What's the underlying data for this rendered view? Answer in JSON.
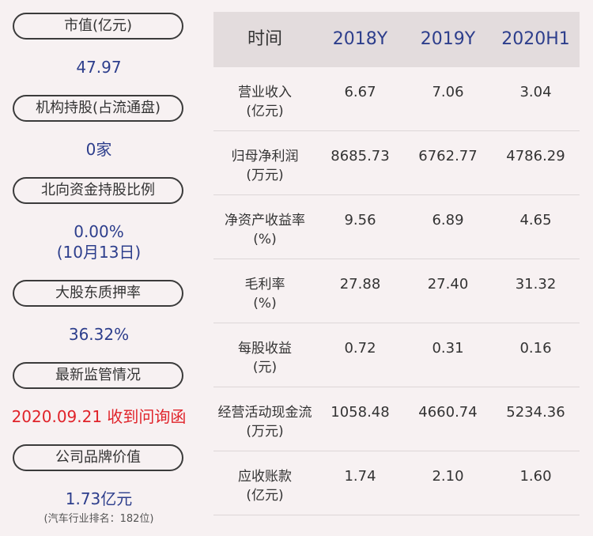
{
  "left": {
    "items": [
      {
        "label": "市值(亿元)",
        "value": "47.97"
      },
      {
        "label": "机构持股(占流通盘)",
        "value": "0家"
      },
      {
        "label": "北向资金持股比例",
        "value": "0.00%",
        "value2": "(10月13日)"
      },
      {
        "label": "大股东质押率",
        "value": "36.32%"
      },
      {
        "label": "最新监管情况",
        "value": "2020.09.21 收到问询函"
      },
      {
        "label": "公司品牌价值",
        "value": "1.73亿元",
        "note": "(汽车行业排名：182位)"
      }
    ],
    "colors": {
      "value": "#2d3e8c",
      "alert": "#e0232a"
    }
  },
  "table": {
    "header": {
      "label": "时间",
      "years": [
        "2018Y",
        "2019Y",
        "2020H1"
      ]
    },
    "rows": [
      {
        "label": "营业收入",
        "unit": "(亿元)",
        "values": [
          "6.67",
          "7.06",
          "3.04"
        ]
      },
      {
        "label": "归母净利润",
        "unit": "(万元)",
        "values": [
          "8685.73",
          "6762.77",
          "4786.29"
        ]
      },
      {
        "label": "净资产收益率",
        "unit": "(%)",
        "values": [
          "9.56",
          "6.89",
          "4.65"
        ]
      },
      {
        "label": "毛利率",
        "unit": "(%)",
        "values": [
          "27.88",
          "27.40",
          "31.32"
        ]
      },
      {
        "label": "每股收益",
        "unit": "(元)",
        "values": [
          "0.72",
          "0.31",
          "0.16"
        ]
      },
      {
        "label": "经营活动现金流",
        "unit": "(万元)",
        "values": [
          "1058.48",
          "4660.74",
          "5234.36"
        ]
      },
      {
        "label": "应收账款",
        "unit": "(亿元)",
        "values": [
          "1.74",
          "2.10",
          "1.60"
        ]
      }
    ]
  }
}
